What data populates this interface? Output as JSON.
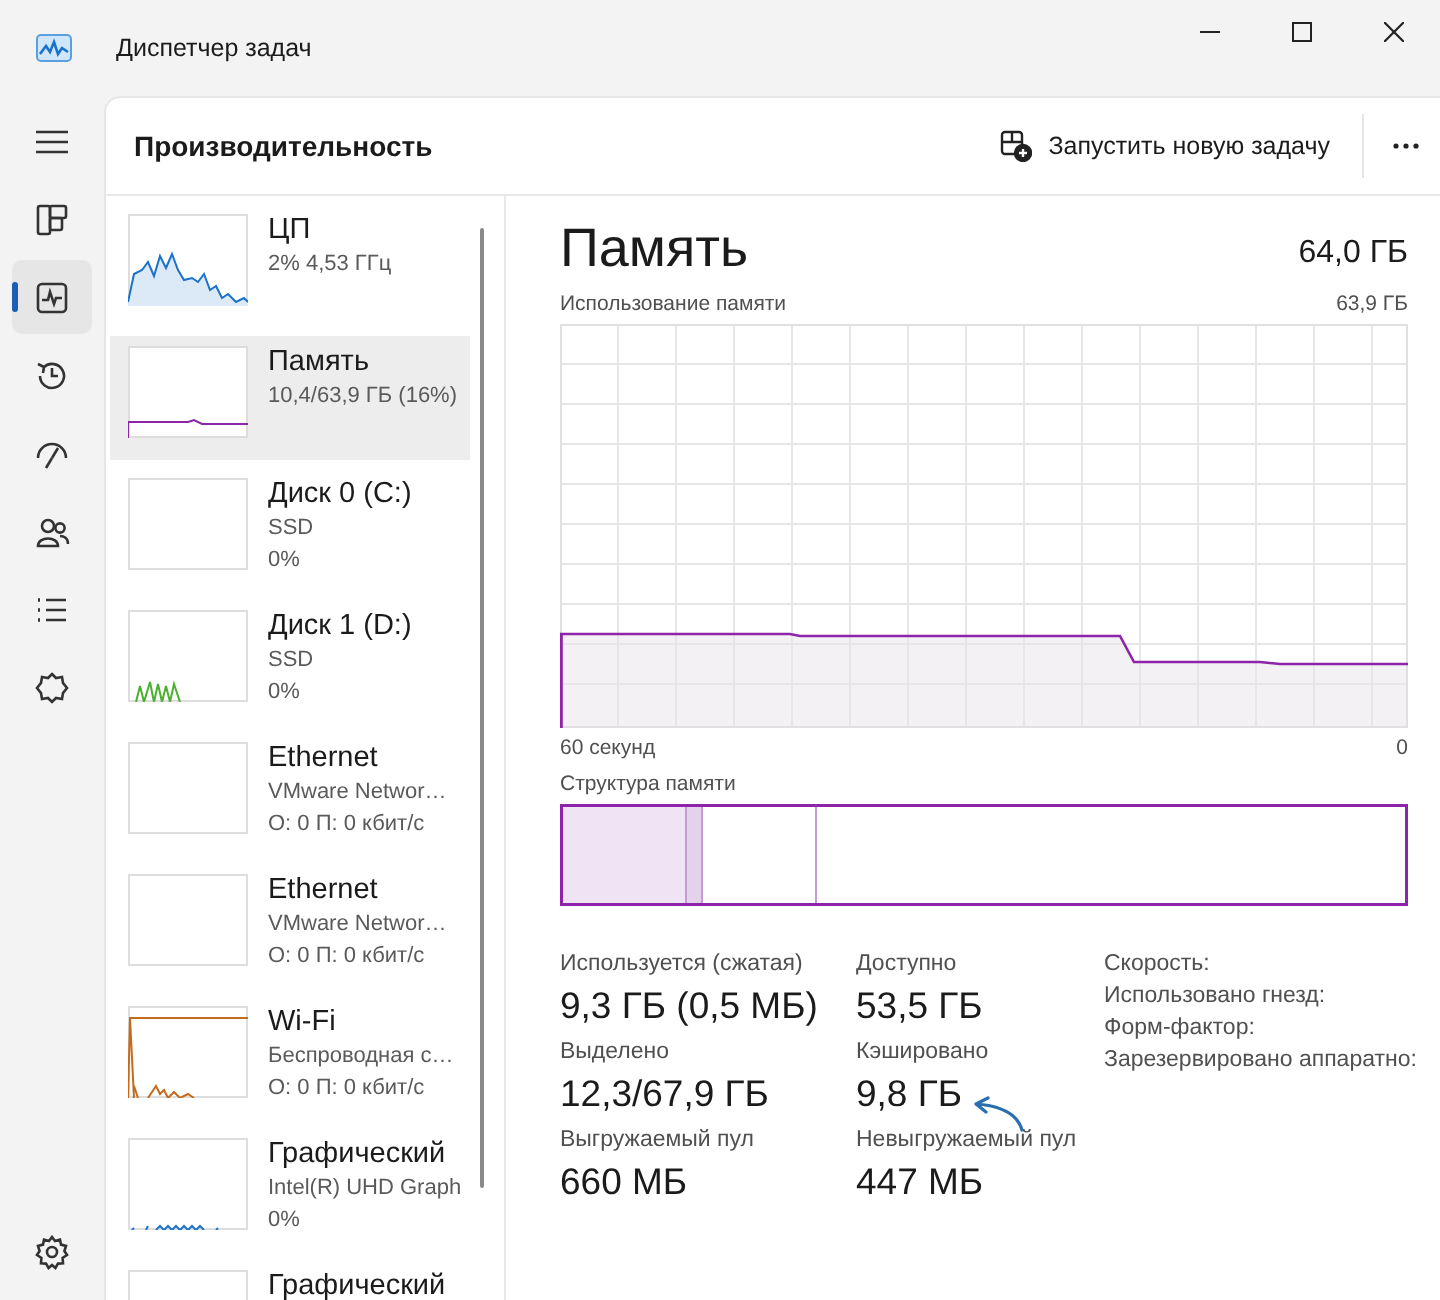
{
  "window": {
    "title": "Диспетчер задач"
  },
  "nav": [
    {
      "kind": "processes",
      "selected": false
    },
    {
      "kind": "performance",
      "selected": true
    },
    {
      "kind": "history",
      "selected": false
    },
    {
      "kind": "startup",
      "selected": false
    },
    {
      "kind": "users",
      "selected": false
    },
    {
      "kind": "details",
      "selected": false
    },
    {
      "kind": "services",
      "selected": false
    }
  ],
  "header": {
    "title": "Производительность",
    "run_task_button": "Запустить новую задачу"
  },
  "devices": [
    {
      "kind": "cpu",
      "title": "ЦП",
      "lines": [
        "2% 4,53 ГГц"
      ],
      "selected": false
    },
    {
      "kind": "memory",
      "title": "Память",
      "lines": [
        "10,4/63,9 ГБ (16%)"
      ],
      "selected": true
    },
    {
      "kind": "blank",
      "title": "Диск 0 (C:)",
      "lines": [
        "SSD",
        "0%"
      ],
      "selected": false
    },
    {
      "kind": "disk",
      "title": "Диск 1 (D:)",
      "lines": [
        "SSD",
        "0%"
      ],
      "selected": false
    },
    {
      "kind": "blank",
      "title": "Ethernet",
      "lines": [
        "VMware Networ…",
        "О: 0 П: 0 кбит/с"
      ],
      "selected": false
    },
    {
      "kind": "blank",
      "title": "Ethernet",
      "lines": [
        "VMware Networ…",
        "О: 0 П: 0 кбит/с"
      ],
      "selected": false
    },
    {
      "kind": "wifi",
      "title": "Wi-Fi",
      "lines": [
        "Беспроводная с…",
        "О: 0 П: 0 кбит/с"
      ],
      "selected": false
    },
    {
      "kind": "gpu",
      "title": "Графический",
      "lines": [
        "Intel(R) UHD Graph",
        "0%"
      ],
      "selected": false
    },
    {
      "kind": "blank",
      "title": "Графический",
      "selected": false
    }
  ],
  "main": {
    "title": "Память",
    "total": "64,0 ГБ",
    "usage_graph": {
      "title": "Использование памяти",
      "max_label": "63,9 ГБ",
      "start_label": "60 секунд",
      "end_label": "0"
    },
    "composition": {
      "title": "Структура памяти"
    },
    "stats": [
      {
        "label": "Используется (сжатая)",
        "value": "9,3 ГБ (0,5 МБ)"
      },
      {
        "label": "Доступно",
        "value": "53,5 ГБ"
      },
      {
        "label": "Выделено",
        "value": "12,3/67,9 ГБ"
      },
      {
        "label": "Кэшировано",
        "value": "9,8 ГБ"
      },
      {
        "label": "Выгружаемый пул",
        "value": "660 МБ"
      },
      {
        "label": "Невыгружаемый пул",
        "value": "447 МБ"
      }
    ],
    "properties": [
      "Скорость:",
      "Использовано гнезд:",
      "Форм-фактор:",
      "Зарезервировано аппаратно:"
    ]
  }
}
